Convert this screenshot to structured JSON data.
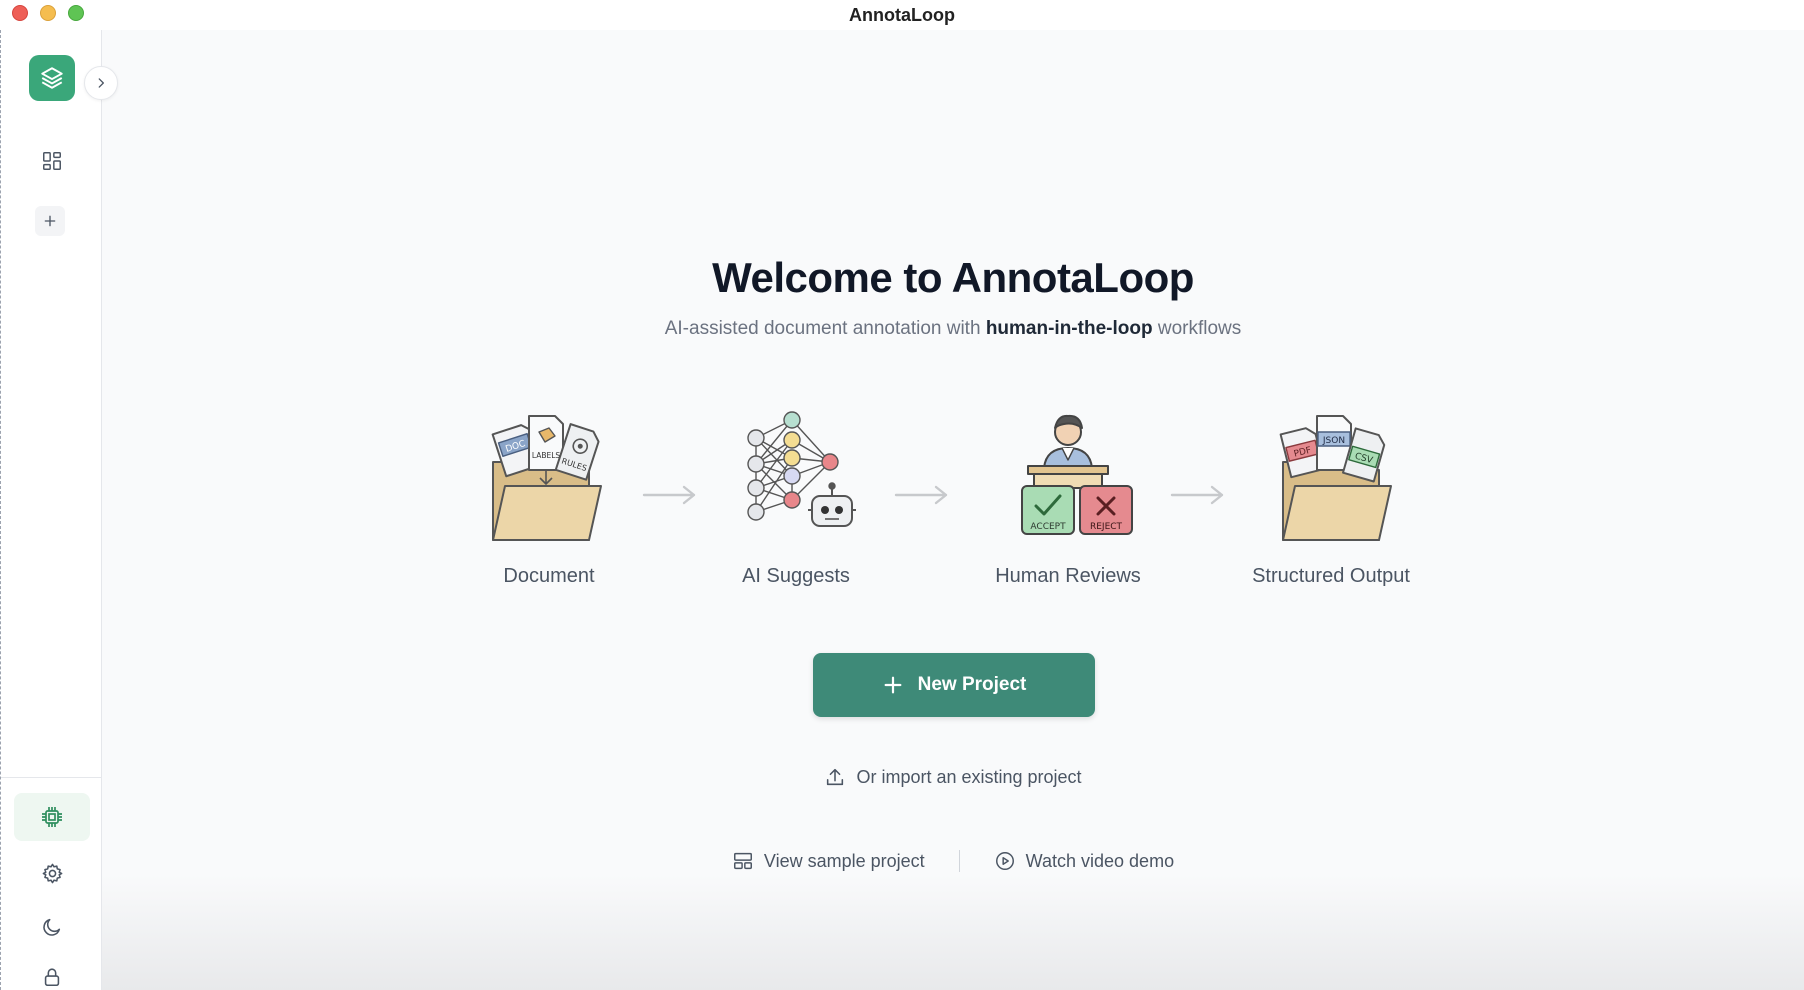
{
  "window": {
    "title": "AnnotaLoop"
  },
  "sidebar": {
    "logo_icon": "layers-icon",
    "collapse_icon": "chevron-right-icon",
    "top_items": [
      {
        "name": "dashboard",
        "icon": "grid-icon"
      },
      {
        "name": "add",
        "icon": "plus-icon"
      }
    ],
    "bottom_items": [
      {
        "name": "model",
        "icon": "cpu-chip-icon",
        "active": true
      },
      {
        "name": "settings",
        "icon": "gear-icon"
      },
      {
        "name": "theme",
        "icon": "moon-icon"
      },
      {
        "name": "lock",
        "icon": "lock-icon"
      }
    ]
  },
  "welcome": {
    "title": "Welcome to AnnotaLoop",
    "subtitle_pre": "AI-assisted document annotation with ",
    "subtitle_bold": "human-in-the-loop",
    "subtitle_post": " workflows"
  },
  "flow": {
    "steps": [
      {
        "label": "Document",
        "icon": "document-folder-icon",
        "tags": [
          "DOC",
          "LABELS",
          "RULES"
        ]
      },
      {
        "label": "AI Suggests",
        "icon": "neural-network-icon"
      },
      {
        "label": "Human Reviews",
        "icon": "human-review-icon",
        "tags": [
          "ACCEPT",
          "REJECT"
        ]
      },
      {
        "label": "Structured Output",
        "icon": "output-folder-icon",
        "tags": [
          "PDF",
          "JSON",
          "CSV"
        ]
      }
    ]
  },
  "actions": {
    "new_project": "New Project",
    "import": "Or import an existing project",
    "view_sample": "View sample project",
    "watch_demo": "Watch video demo"
  },
  "colors": {
    "accent": "#3e8a78",
    "logo": "#3aa77a",
    "text_muted": "#6b7280"
  }
}
